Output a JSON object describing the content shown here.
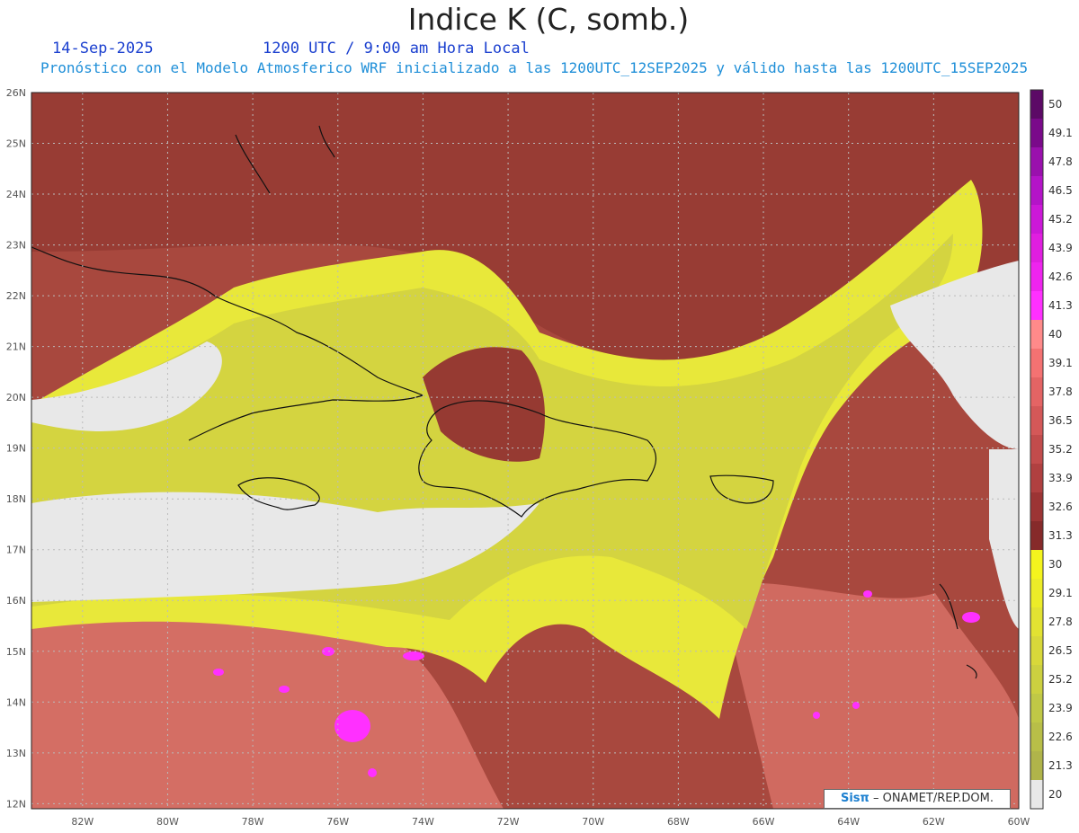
{
  "title": "Indice K (C, somb.)",
  "date": "14-Sep-2025",
  "time": "1200 UTC / 9:00 am Hora Local",
  "subtitle": "Pronóstico con el Modelo Atmosferico WRF inicializado a las 1200UTC_12SEP2025 y válido hasta las  1200UTC_15SEP2025",
  "credit_logo": "Sisπ",
  "credit_text": "– ONAMET/REP.DOM.",
  "lat_labels": [
    "26N",
    "25N",
    "24N",
    "23N",
    "22N",
    "21N",
    "20N",
    "19N",
    "18N",
    "17N",
    "16N",
    "15N",
    "14N",
    "13N",
    "12N"
  ],
  "lon_labels": [
    "82W",
    "80W",
    "78W",
    "76W",
    "74W",
    "72W",
    "70W",
    "68W",
    "66W",
    "64W",
    "62W",
    "60W"
  ],
  "colorbar": {
    "labels": [
      "50",
      "49.1",
      "47.8",
      "46.5",
      "45.2",
      "43.9",
      "42.6",
      "41.3",
      "40",
      "39.1",
      "37.8",
      "36.5",
      "35.2",
      "33.9",
      "32.6",
      "31.3",
      "30",
      "29.1",
      "27.8",
      "26.5",
      "25.2",
      "23.9",
      "22.6",
      "21.3",
      "20"
    ],
    "colors": [
      "#5c0a66",
      "#7a0a8a",
      "#9a10ad",
      "#b414c8",
      "#cc18d8",
      "#e01ee0",
      "#ee24ee",
      "#ff30ff",
      "#ff8a8a",
      "#f47272",
      "#e46464",
      "#d45858",
      "#c24c4c",
      "#b04040",
      "#9c3434",
      "#862a2a",
      "#f4f41e",
      "#ecec28",
      "#e2e232",
      "#d8d83a",
      "#ccd040",
      "#c0c846",
      "#b8be48",
      "#b0b44a",
      "#e8e8e8"
    ]
  },
  "palette": {
    "background": "#ffffff",
    "no_data": "#e8e8e8",
    "coast": "#111111",
    "grid": "#bbbbbb",
    "title_blue": "#1a3fcf",
    "subtitle_blue": "#1f8fd8"
  }
}
